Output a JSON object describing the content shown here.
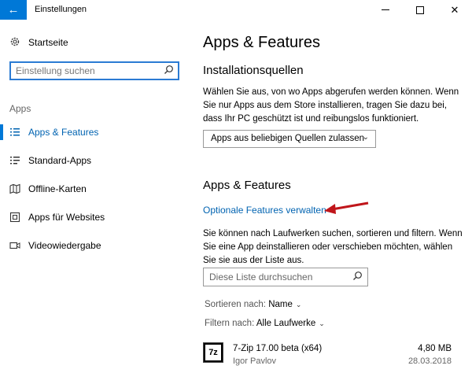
{
  "window": {
    "title": "Einstellungen"
  },
  "sidebar": {
    "home_label": "Startseite",
    "search_placeholder": "Einstellung suchen",
    "section_label": "Apps",
    "items": [
      {
        "label": "Apps & Features",
        "icon": "list-icon",
        "active": true
      },
      {
        "label": "Standard-Apps",
        "icon": "default-apps-icon",
        "active": false
      },
      {
        "label": "Offline-Karten",
        "icon": "map-icon",
        "active": false
      },
      {
        "label": "Apps für Websites",
        "icon": "web-apps-icon",
        "active": false
      },
      {
        "label": "Videowiedergabe",
        "icon": "video-icon",
        "active": false
      }
    ]
  },
  "main": {
    "title": "Apps & Features",
    "install_sources": {
      "heading": "Installationsquellen",
      "description": "Wählen Sie aus, von wo Apps abgerufen werden können. Wenn Sie nur Apps aus dem Store installieren, tragen Sie dazu bei, dass Ihr PC geschützt ist und reibungslos funktioniert.",
      "dropdown_value": "Apps aus beliebigen Quellen zulassen"
    },
    "apps_features": {
      "heading": "Apps & Features",
      "link": "Optionale Features verwalten",
      "description": "Sie können nach Laufwerken suchen, sortieren und filtern. Wenn Sie eine App deinstallieren oder verschieben möchten, wählen Sie sie aus der Liste aus.",
      "search_placeholder": "Diese Liste durchsuchen",
      "sort_label": "Sortieren nach:",
      "sort_value": "Name",
      "filter_label": "Filtern nach:",
      "filter_value": "Alle Laufwerke"
    },
    "apps": [
      {
        "name": "7-Zip 17.00 beta (x64)",
        "publisher": "Igor Pavlov",
        "size": "4,80 MB",
        "date": "28.03.2018",
        "icon_text": "7z"
      }
    ]
  },
  "colors": {
    "accent": "#0078d7",
    "link": "#0063b1",
    "annotation_arrow": "#c0161b"
  }
}
